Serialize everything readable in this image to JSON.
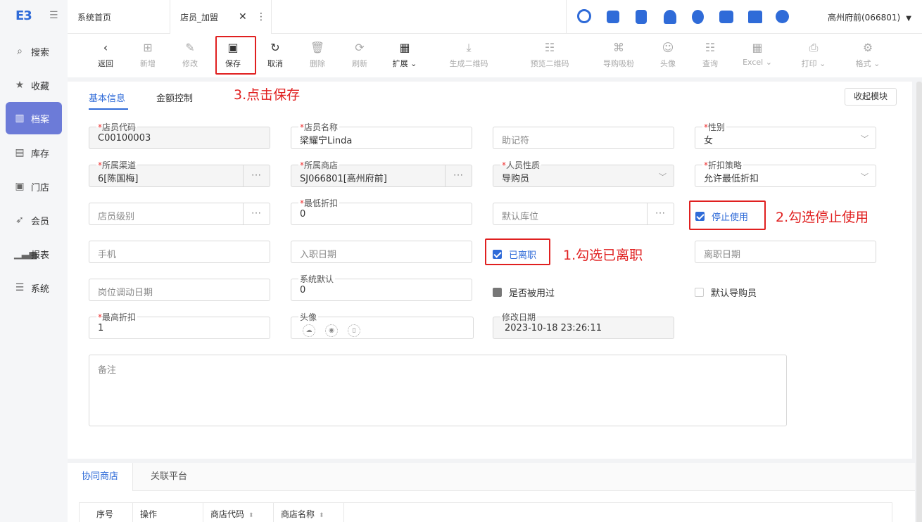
{
  "app": {
    "logo": "E3"
  },
  "sidebar": {
    "items": [
      {
        "label": "搜索",
        "icon": "search-icon"
      },
      {
        "label": "收藏",
        "icon": "star-icon"
      },
      {
        "label": "档案",
        "icon": "archive-icon",
        "active": true
      },
      {
        "label": "库存",
        "icon": "inventory-icon"
      },
      {
        "label": "门店",
        "icon": "store-icon"
      },
      {
        "label": "会员",
        "icon": "rocket-icon"
      },
      {
        "label": "报表",
        "icon": "report-icon"
      },
      {
        "label": "系统",
        "icon": "system-icon"
      }
    ]
  },
  "tabs": {
    "home": "系统首页",
    "current": "店员_加盟"
  },
  "header": {
    "store": "高州府前(066801)"
  },
  "toolbar": {
    "back": "返回",
    "add": "新增",
    "edit": "修改",
    "save": "保存",
    "cancel": "取消",
    "delete": "删除",
    "refresh": "刷新",
    "extend": "扩展",
    "gen_qr": "生成二维码",
    "preview_qr": "预览二维码",
    "guide_fans": "导购吸粉",
    "avatar": "头像",
    "query": "查询",
    "excel": "Excel",
    "print": "打印",
    "format": "格式"
  },
  "form": {
    "tabs": [
      "基本信息",
      "金额控制"
    ],
    "collapse": "收起模块",
    "staff_code": {
      "label": "店员代码",
      "value": "C00100003"
    },
    "staff_name": {
      "label": "店员名称",
      "value": "梁耀宁Linda"
    },
    "mnemonic": {
      "placeholder": "助记符"
    },
    "gender": {
      "label": "性别",
      "value": "女"
    },
    "channel": {
      "label": "所属渠道",
      "value": "6[陈国梅]"
    },
    "store": {
      "label": "所属商店",
      "value": "SJ066801[高州府前]"
    },
    "staff_type": {
      "label": "人员性质",
      "value": "导购员"
    },
    "discount_policy": {
      "label": "折扣策略",
      "value": "允许最低折扣"
    },
    "staff_level": {
      "placeholder": "店员级别"
    },
    "min_discount": {
      "label": "最低折扣",
      "value": "0"
    },
    "default_location": {
      "placeholder": "默认库位"
    },
    "stop_use": {
      "label": "停止使用",
      "checked": true
    },
    "phone": {
      "placeholder": "手机"
    },
    "hire_date": {
      "placeholder": "入职日期"
    },
    "resigned": {
      "label": "已离职",
      "checked": true
    },
    "resign_date": {
      "placeholder": "离职日期"
    },
    "transfer_date": {
      "placeholder": "岗位调动日期"
    },
    "system_default": {
      "label": "系统默认",
      "value": "0"
    },
    "used": {
      "label": "是否被用过"
    },
    "default_guide": {
      "label": "默认导购员"
    },
    "max_discount": {
      "label": "最高折扣",
      "value": "1"
    },
    "avatar": {
      "label": "头像"
    },
    "modify_date": {
      "label": "修改日期",
      "value": "2023-10-18 23:26:11"
    },
    "remarks": {
      "placeholder": "备注"
    }
  },
  "annotations": {
    "step1": "1.勾选已离职",
    "step2": "2.勾选停止使用",
    "step3": "3.点击保存"
  },
  "bottom": {
    "tabs": [
      "协同商店",
      "关联平台"
    ],
    "columns": [
      "序号",
      "操作",
      "商店代码",
      "商店名称"
    ]
  },
  "colors": {
    "accent": "#2f6bd8",
    "annotation": "#e02020",
    "sidebar_active": "#6c7bd8"
  }
}
